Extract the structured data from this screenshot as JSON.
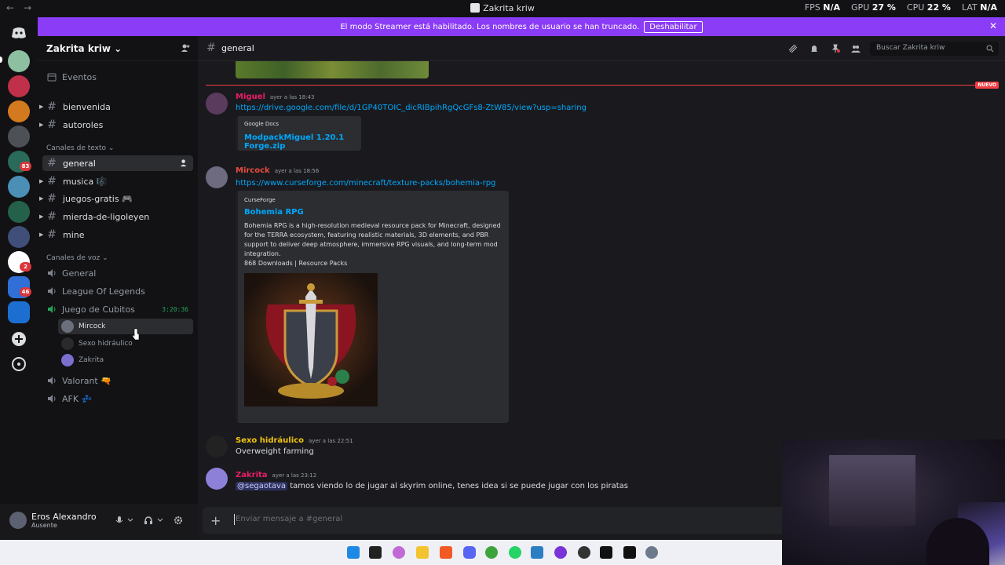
{
  "titlebar": {
    "title": "Zakrita kriw",
    "nav_back": "←",
    "nav_forward": "→",
    "stats": [
      {
        "label": "FPS",
        "value": "N/A"
      },
      {
        "label": "GPU",
        "value": "27 %"
      },
      {
        "label": "CPU",
        "value": "22 %"
      },
      {
        "label": "LAT",
        "value": "N/A"
      }
    ]
  },
  "banner": {
    "text": "El modo Streamer está habilitado. Los nombres de usuario se han truncado.",
    "button": "Deshabilitar",
    "close": "✕"
  },
  "rail": {
    "badges": [
      "83",
      "2",
      "46"
    ]
  },
  "server": {
    "name": "Zakrita kriw",
    "chevron": "⌄"
  },
  "sidebar": {
    "events": "Eventos",
    "channels_top": [
      "bienvenida",
      "autoroles"
    ],
    "text_category": "Canales de texto",
    "text_channels": [
      "general",
      "musica 🎼",
      "juegos-gratis 🎮",
      "mierda-de-ligoleyen",
      "mine"
    ],
    "voice_category": "Canales de voz",
    "voice_channels": [
      "General",
      "League Of Legends",
      "Juego de Cubitos"
    ],
    "voice_timer": "3:20:36",
    "voice_users": [
      "Mircock",
      "Sexo hidráulico",
      "Zakrita"
    ],
    "voice_channels_after": [
      "Valorant 🔫",
      "AFK 💤"
    ]
  },
  "user": {
    "name": "Eros Alexandro",
    "status": "Ausente"
  },
  "channel_header": {
    "name": "general",
    "search_placeholder": "Buscar Zakrita kriw"
  },
  "chat": {
    "new_tag": "NUEVO",
    "messages": [
      {
        "author": "Miguel",
        "author_color": "#e91e63",
        "timestamp": "ayer a las 18:43",
        "link": "https://drive.google.com/file/d/1GP40TOIC_dicRIBpihRgQcGFs8-ZtW85/view?usp=sharing",
        "embed_provider": "Google Docs",
        "embed_title": "ModpackMiguel 1.20.1 Forge.zip"
      },
      {
        "author": "Mircock",
        "author_color": "#e74c3c",
        "timestamp": "ayer a las 18:56",
        "link": "https://www.curseforge.com/minecraft/texture-packs/bohemia-rpg",
        "embed_provider": "CurseForge",
        "embed_title": "Bohemia RPG",
        "embed_desc_lines": [
          "Bohemia RPG is a high-resolution medieval resource pack for Minecraft, designed",
          "for the TERRA ecosystem, featuring realistic materials, 3D elements, and PBR",
          "support to deliver deep atmosphere, immersive RPG visuals, and long-term mod",
          "integration.",
          "868 Downloads | Resource Packs"
        ]
      },
      {
        "author": "Sexo hidráulico",
        "author_color": "#f1c40f",
        "timestamp": "ayer a las 22:51",
        "text": "Overweight farming"
      },
      {
        "author": "Zakrita",
        "author_color": "#e91e63",
        "timestamp": "ayer a las 23:12",
        "mention": "@segaotava",
        "text": " tamos viendo lo de jugar al skyrim online, tenes idea si se puede jugar con los piratas"
      }
    ]
  },
  "composer": {
    "placeholder": "Enviar mensaje a #general",
    "plus": "+"
  }
}
